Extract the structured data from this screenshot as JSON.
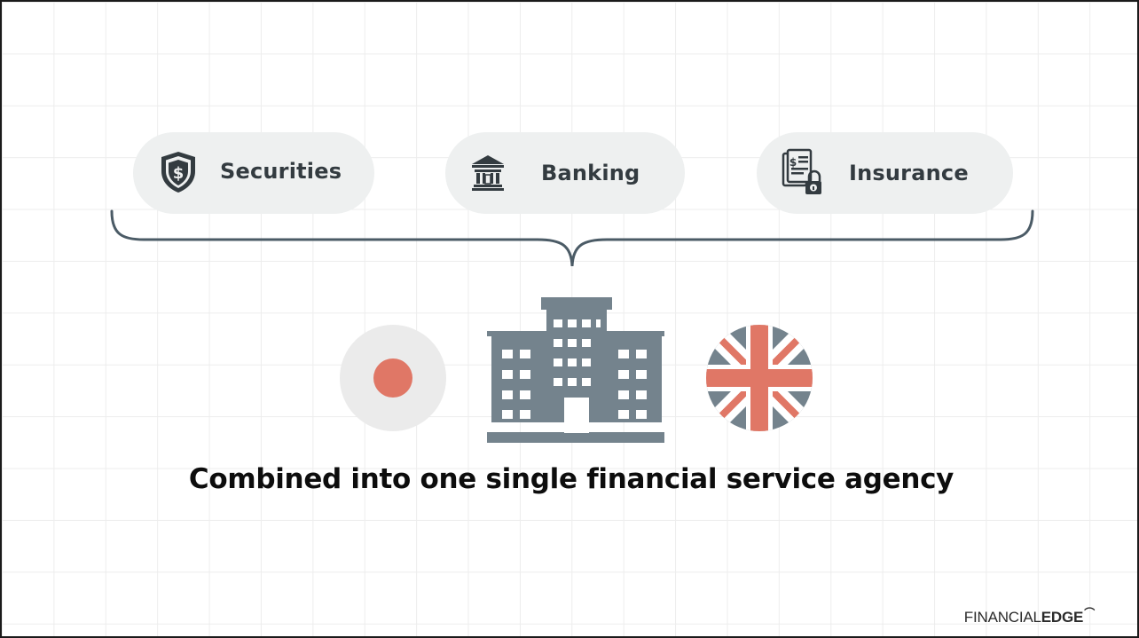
{
  "categories": [
    {
      "label": "Securities",
      "icon": "shield-dollar-icon"
    },
    {
      "label": "Banking",
      "icon": "bank-icon"
    },
    {
      "label": "Insurance",
      "icon": "insurance-document-icon"
    }
  ],
  "caption": "Combined into one single financial service agency",
  "logo": {
    "light": "FINANCIAL",
    "bold": "EDGE"
  },
  "colors": {
    "slate": "#74838d",
    "text_dark": "#333b40",
    "pill_bg": "#eef0f0",
    "japan_red": "#e07766",
    "japan_disc": "#ebebeb",
    "uk_red": "#e07766",
    "uk_blue": "#74838d"
  },
  "icons": [
    "japan-flag-icon",
    "building-icon",
    "uk-flag-icon"
  ]
}
